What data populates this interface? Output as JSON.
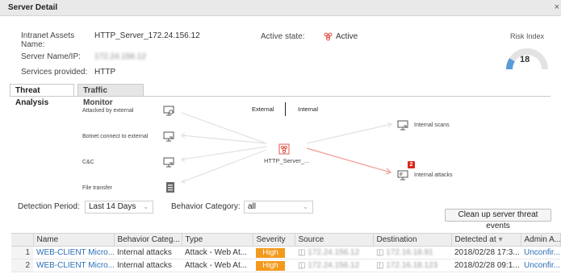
{
  "window": {
    "title": "Server Detail",
    "close_symbol": "×"
  },
  "info": {
    "intranet_assets_label_1": "Intranet Assets",
    "intranet_assets_label_2": "Name:",
    "intranet_assets_value": "HTTP_Server_172.24.156.12",
    "server_name_label": "Server Name/IP:",
    "server_name_value": "172.24.156.12",
    "services_label": "Services provided:",
    "services_value": "HTTP",
    "active_state_label": "Active state:",
    "active_state_value": "Active"
  },
  "risk": {
    "label": "Risk Index",
    "value": "18",
    "level_fraction": 0.18,
    "color": "#5b9bd5"
  },
  "tabs": [
    {
      "label": "Threat Analysis",
      "active": true
    },
    {
      "label": "Traffic Monitor",
      "active": false
    }
  ],
  "diagram": {
    "segments": [
      "External",
      "Internal"
    ],
    "center_label": "HTTP_Server_...",
    "left_items": [
      "Attacked by external",
      "Botnet connect to external",
      "C&C",
      "File transfer"
    ],
    "right_items": [
      "Internal scans",
      "Internal attacks"
    ],
    "internal_attacks_count": "2",
    "accent_color": "#e05a4e"
  },
  "filters": {
    "detection_period_label": "Detection Period:",
    "detection_period_value": "Last 14 Days",
    "behavior_category_label": "Behavior Category:",
    "behavior_category_value": "all",
    "cleanup_button": "Clean up server threat events"
  },
  "table": {
    "columns": [
      "Name",
      "Behavior Categ...",
      "Type",
      "Severity",
      "Source",
      "Destination",
      "Detected at",
      "Admin A..."
    ],
    "sort_indicator": "▾",
    "rows": [
      {
        "num": "1",
        "name": "WEB-CLIENT Micro...",
        "category": "Internal attacks",
        "type": "Attack - Web At...",
        "severity": "High",
        "source": "172.24.156.12",
        "destination": "172.16.18.91",
        "detected": "2018/02/28 17:3...",
        "admin": "Unconfir..."
      },
      {
        "num": "2",
        "name": "WEB-CLIENT Micro...",
        "category": "Internal attacks",
        "type": "Attack - Web At...",
        "severity": "High",
        "source": "172.24.156.12",
        "destination": "172.16.18.123",
        "detected": "2018/02/28 09:1...",
        "admin": "Unconfir..."
      }
    ],
    "severity_color": "#f39a1c",
    "link_color": "#2a6fb5"
  }
}
